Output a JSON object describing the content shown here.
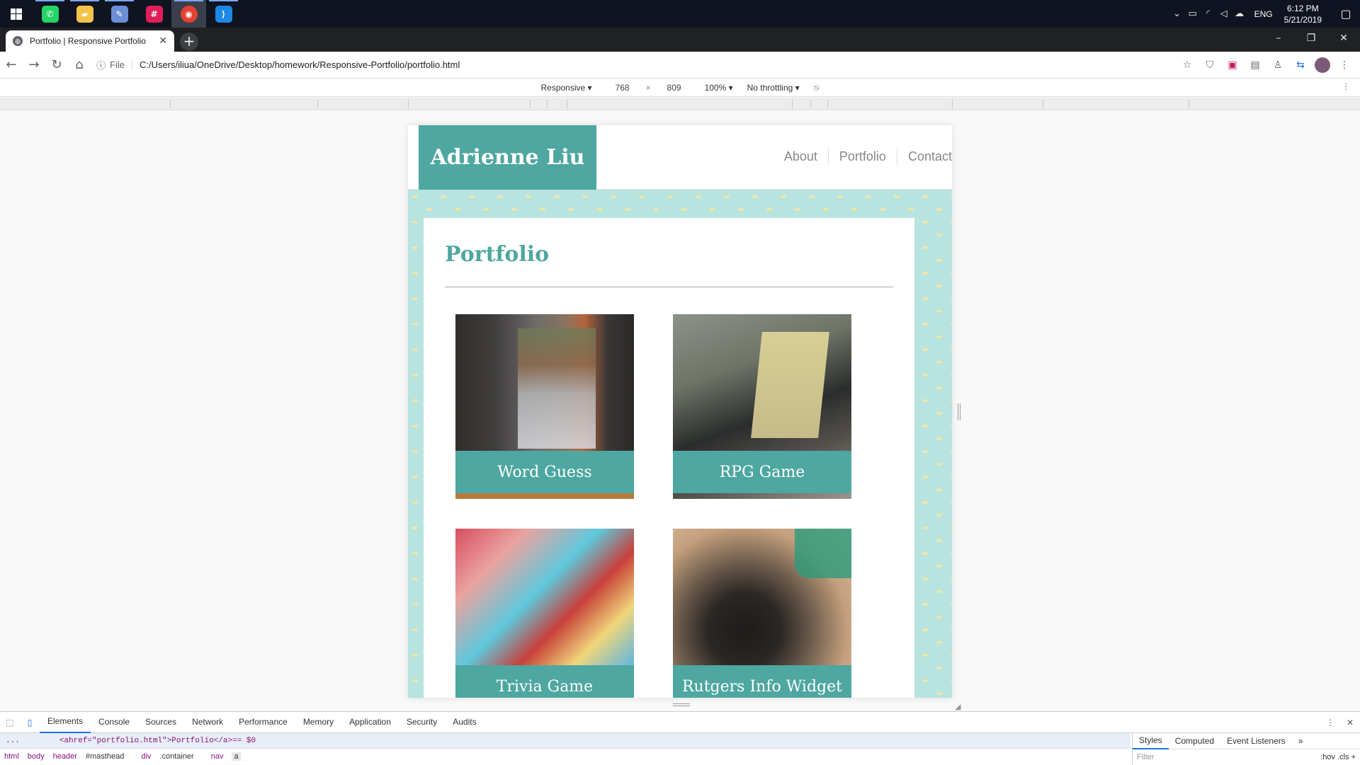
{
  "taskbar": {
    "apps": [
      {
        "name": "WhatsApp",
        "glyph": "✆",
        "color": "#25d366"
      },
      {
        "name": "File Explorer",
        "glyph": "▰",
        "color": "#f2c24b"
      },
      {
        "name": "Paint",
        "glyph": "✎",
        "color": "#6b8fd6"
      },
      {
        "name": "Slack",
        "glyph": "#",
        "color": "#e01e5a"
      },
      {
        "name": "Chrome",
        "glyph": "◉",
        "color": "#e34133"
      },
      {
        "name": "VS Code",
        "glyph": "⟩",
        "color": "#1e88e5"
      }
    ],
    "language": "ENG",
    "time": "6:12 PM",
    "date": "5/21/2019"
  },
  "browser": {
    "tab_title": "Portfolio | Responsive Portfolio",
    "file_label": "File",
    "url": "C:/Users/iliua/OneDrive/Desktop/homework/Responsive-Portfolio/portfolio.html"
  },
  "device_toolbar": {
    "device": "Responsive ▾",
    "width": "768",
    "times": "×",
    "height": "809",
    "zoom": "100% ▾",
    "throttling": "No throttling ▾"
  },
  "site": {
    "brand": "Adrienne Liu",
    "nav": [
      "About",
      "Portfolio",
      "Contact"
    ],
    "page_title": "Portfolio",
    "projects": [
      "Word Guess",
      "RPG Game",
      "Trivia Game",
      "Rutgers Info Widget"
    ]
  },
  "devtools": {
    "tabs": [
      "Elements",
      "Console",
      "Sources",
      "Network",
      "Performance",
      "Memory",
      "Application",
      "Security",
      "Audits"
    ],
    "selected_tab": "Elements",
    "code": {
      "ellipsis": "...",
      "open": "<a ",
      "attr": "href=",
      "value": "\"portfolio.html\"",
      "close": ">",
      "text": "Portfolio",
      "end": "</a>",
      "marker": " == $0"
    },
    "breadcrumbs": [
      "html",
      "body",
      "header",
      "#masthead",
      "div",
      ".container",
      "nav",
      "a"
    ],
    "side_tabs": [
      "Styles",
      "Computed",
      "Event Listeners",
      "»"
    ],
    "filter_placeholder": "Filter",
    "filter_tools": ":hov  .cls  +"
  },
  "colors": {
    "accent": "#4ea7a0",
    "pattern_bg": "#b7e4de"
  }
}
